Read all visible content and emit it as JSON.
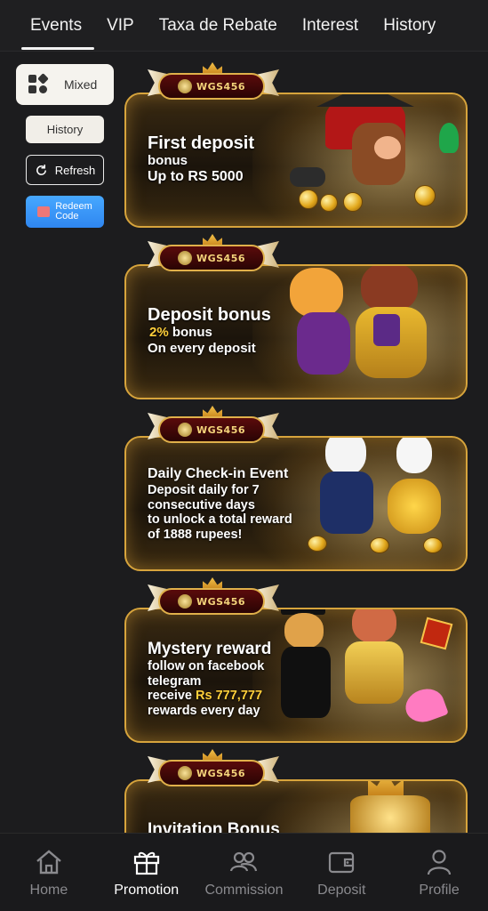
{
  "tabs": [
    {
      "label": "Events",
      "active": true
    },
    {
      "label": "VIP",
      "active": false
    },
    {
      "label": "Taxa de Rebate",
      "active": false
    },
    {
      "label": "Interest",
      "active": false
    },
    {
      "label": "History",
      "active": false
    }
  ],
  "sidebar": {
    "mixed_label": "Mixed",
    "history_label": "History",
    "refresh_label": "Refresh",
    "redeem_line1": "Redeem",
    "redeem_line2": "Code"
  },
  "badge_text": "WGS456",
  "cards": [
    {
      "title": "First deposit",
      "lines": [
        "bonus",
        "Up to RS 5000"
      ]
    },
    {
      "title": "Deposit bonus",
      "line1_gold": "2%",
      "line1_rest": " bonus",
      "lines": [
        "On every deposit"
      ]
    },
    {
      "title": "Daily Check-in Event",
      "lines": [
        "Deposit daily for 7",
        "consecutive days",
        "to unlock a total reward",
        "of 1888 rupees!"
      ]
    },
    {
      "title": "Mystery reward",
      "lines": [
        "follow on facebook",
        "telegram"
      ],
      "receive_prefix": "receive ",
      "receive_gold": "Rs 777,777",
      "last_line": "rewards every day"
    },
    {
      "title": "Invitation Bonus"
    }
  ],
  "bottom_nav": [
    {
      "label": "Home",
      "icon": "home-icon",
      "active": false
    },
    {
      "label": "Promotion",
      "icon": "gift-icon",
      "active": true
    },
    {
      "label": "Commission",
      "icon": "people-icon",
      "active": false
    },
    {
      "label": "Deposit",
      "icon": "wallet-icon",
      "active": false
    },
    {
      "label": "Profile",
      "icon": "user-icon",
      "active": false
    }
  ],
  "colors": {
    "background": "#1c1c1e",
    "card_border": "#d7a43c",
    "accent_gold": "#ffcf3a",
    "redeem_blue": "#2f86f0"
  }
}
